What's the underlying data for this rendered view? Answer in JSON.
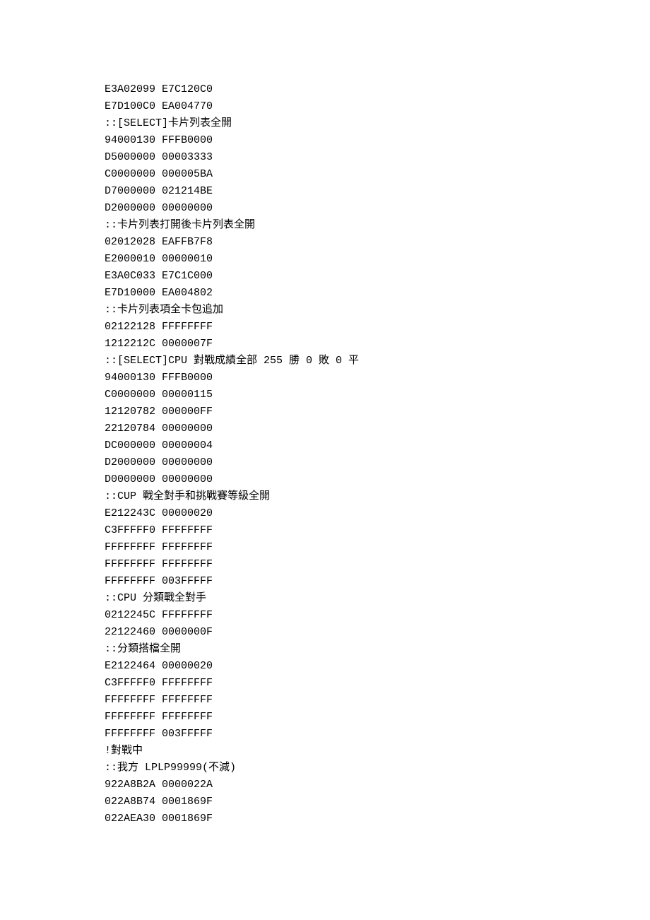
{
  "lines": [
    "E3A02099 E7C120C0",
    "E7D100C0 EA004770",
    "::[SELECT]卡片列表全開",
    "94000130 FFFB0000",
    "D5000000 00003333",
    "C0000000 000005BA",
    "D7000000 021214BE",
    "D2000000 00000000",
    "::卡片列表打開後卡片列表全開",
    "02012028 EAFFB7F8",
    "E2000010 00000010",
    "E3A0C033 E7C1C000",
    "E7D10000 EA004802",
    "::卡片列表項全卡包追加",
    "02122128 FFFFFFFF",
    "1212212C 0000007F",
    "::[SELECT]CPU 對戰成績全部 255 勝 0 敗 0 平",
    "94000130 FFFB0000",
    "C0000000 00000115",
    "12120782 000000FF",
    "22120784 00000000",
    "DC000000 00000004",
    "D2000000 00000000",
    "D0000000 00000000",
    "::CUP 戰全對手和挑戰賽等級全開",
    "E212243C 00000020",
    "C3FFFFF0 FFFFFFFF",
    "FFFFFFFF FFFFFFFF",
    "FFFFFFFF FFFFFFFF",
    "FFFFFFFF 003FFFFF",
    "::CPU 分類戰全對手",
    "0212245C FFFFFFFF",
    "22122460 0000000F",
    "::分類搭檔全開",
    "E2122464 00000020",
    "C3FFFFF0 FFFFFFFF",
    "FFFFFFFF FFFFFFFF",
    "FFFFFFFF FFFFFFFF",
    "FFFFFFFF 003FFFFF",
    "!對戰中",
    "::我方 LPLP99999(不減)",
    "922A8B2A 0000022A",
    "022A8B74 0001869F",
    "022AEA30 0001869F"
  ]
}
